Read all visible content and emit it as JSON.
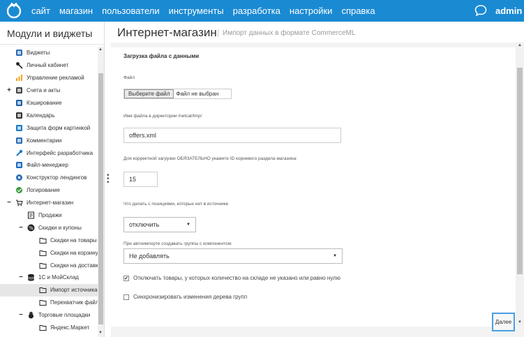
{
  "topbar": {
    "nav": [
      "сайт",
      "магазин",
      "пользователи",
      "инструменты",
      "разработка",
      "настройки",
      "справка"
    ],
    "user": "admin",
    "color": "#1a8ad3"
  },
  "sidebar": {
    "title": "Модули и виджеты",
    "items": [
      {
        "label": "Виджеты",
        "icon": "widgets-icon",
        "toggle": ""
      },
      {
        "label": "Личный кабинет",
        "icon": "key-icon",
        "toggle": ""
      },
      {
        "label": "Управление рекламой",
        "icon": "bar-chart-icon",
        "toggle": ""
      },
      {
        "label": "Счета и акты",
        "icon": "document-icon",
        "toggle": "+"
      },
      {
        "label": "Кэширование",
        "icon": "storage-icon",
        "toggle": ""
      },
      {
        "label": "Календарь",
        "icon": "calendar-icon",
        "toggle": ""
      },
      {
        "label": "Защита форм картинкой",
        "icon": "captcha-icon",
        "toggle": ""
      },
      {
        "label": "Комментарии",
        "icon": "comments-icon",
        "toggle": ""
      },
      {
        "label": "Интерфейс разработчика",
        "icon": "wrench-icon",
        "toggle": ""
      },
      {
        "label": "Файл-менеджер",
        "icon": "file-manager-icon",
        "toggle": ""
      },
      {
        "label": "Конструктор лендингов",
        "icon": "gear-icon",
        "toggle": ""
      },
      {
        "label": "Логирование",
        "icon": "logging-icon",
        "toggle": ""
      },
      {
        "label": "Интернет-магазин",
        "icon": "cart-icon",
        "toggle": "−"
      },
      {
        "label": "Продажи",
        "icon": "sales-icon",
        "toggle": ""
      },
      {
        "label": "Скидки и купоны",
        "icon": "percent-icon",
        "toggle": "−"
      },
      {
        "label": "Скидки на товары",
        "icon": "folder-icon",
        "toggle": ""
      },
      {
        "label": "Скидки на корзину",
        "icon": "folder-icon",
        "toggle": ""
      },
      {
        "label": "Скидки на доставку",
        "icon": "folder-icon",
        "toggle": ""
      },
      {
        "label": "1С и МойСклад",
        "icon": "database-icon",
        "toggle": "−"
      },
      {
        "label": "Импорт источника",
        "icon": "folder-icon",
        "toggle": ""
      },
      {
        "label": "Перехватчик файлов",
        "icon": "folder-icon",
        "toggle": ""
      },
      {
        "label": "Торговые площадки",
        "icon": "marketplace-icon",
        "toggle": "−"
      },
      {
        "label": "Яндекс.Маркет",
        "icon": "folder-icon",
        "toggle": ""
      }
    ]
  },
  "page": {
    "title": "Интернет-магазин",
    "subtitle": "Импорт данных в формате CommerceML"
  },
  "form": {
    "section": "Загрузка файла с данными",
    "file_label": "Файл",
    "file_button": "Выберите файл",
    "file_none": "Файл не выбран",
    "filename_label": "Имя файла в директории /netcat/tmp/",
    "filename_value": "offers.xml",
    "root_id_label": "Для корректной загрузки ОБЯЗАТЕЛЬНО укажите ID корневого раздела магазина:",
    "root_id_value": "15",
    "missing_label": "Что делать с позициями, которых нет в источнике",
    "missing_value": "отключить",
    "groups_label": "При автоимпорте создавать группы с компонентом:",
    "groups_value": "Не добавлять",
    "disable_zero_label": "Отключать товары, у которых количество на складе не указано или равно нулю",
    "sync_tree_label": "Синхронизировать изменения дерева групп"
  },
  "footer": {
    "next_label": "Далее"
  }
}
